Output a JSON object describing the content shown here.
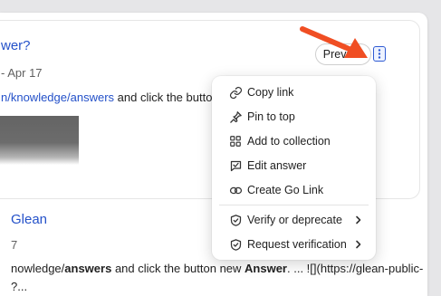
{
  "result1": {
    "title": "wer?",
    "date": "- Apr 17",
    "snippet_link": "n/knowledge/answers",
    "snippet_rest": " and click the button"
  },
  "preview_label": "Preview",
  "result2": {
    "title": "Glean",
    "date": "7",
    "line1_a": "nowledge/",
    "line1_b": "answers",
    "line1_c": " and click the button new ",
    "line1_d": "Answer",
    "line1_e": ". ... ![](https://glean-public-",
    "line2": "?..."
  },
  "menu": {
    "items": [
      {
        "label": "Copy link",
        "icon": "link-icon"
      },
      {
        "label": "Pin to top",
        "icon": "pin-icon"
      },
      {
        "label": "Add to collection",
        "icon": "collection-icon"
      },
      {
        "label": "Edit answer",
        "icon": "edit-answer-icon"
      },
      {
        "label": "Create Go Link",
        "icon": "go-link-icon"
      },
      {
        "label": "Verify or deprecate",
        "icon": "shield-check-icon",
        "submenu": true
      },
      {
        "label": "Request verification",
        "icon": "shield-check-icon",
        "submenu": true
      }
    ]
  },
  "colors": {
    "link": "#2451c9",
    "accent_button": "#2f5bd3",
    "arrow": "#f04e23"
  }
}
